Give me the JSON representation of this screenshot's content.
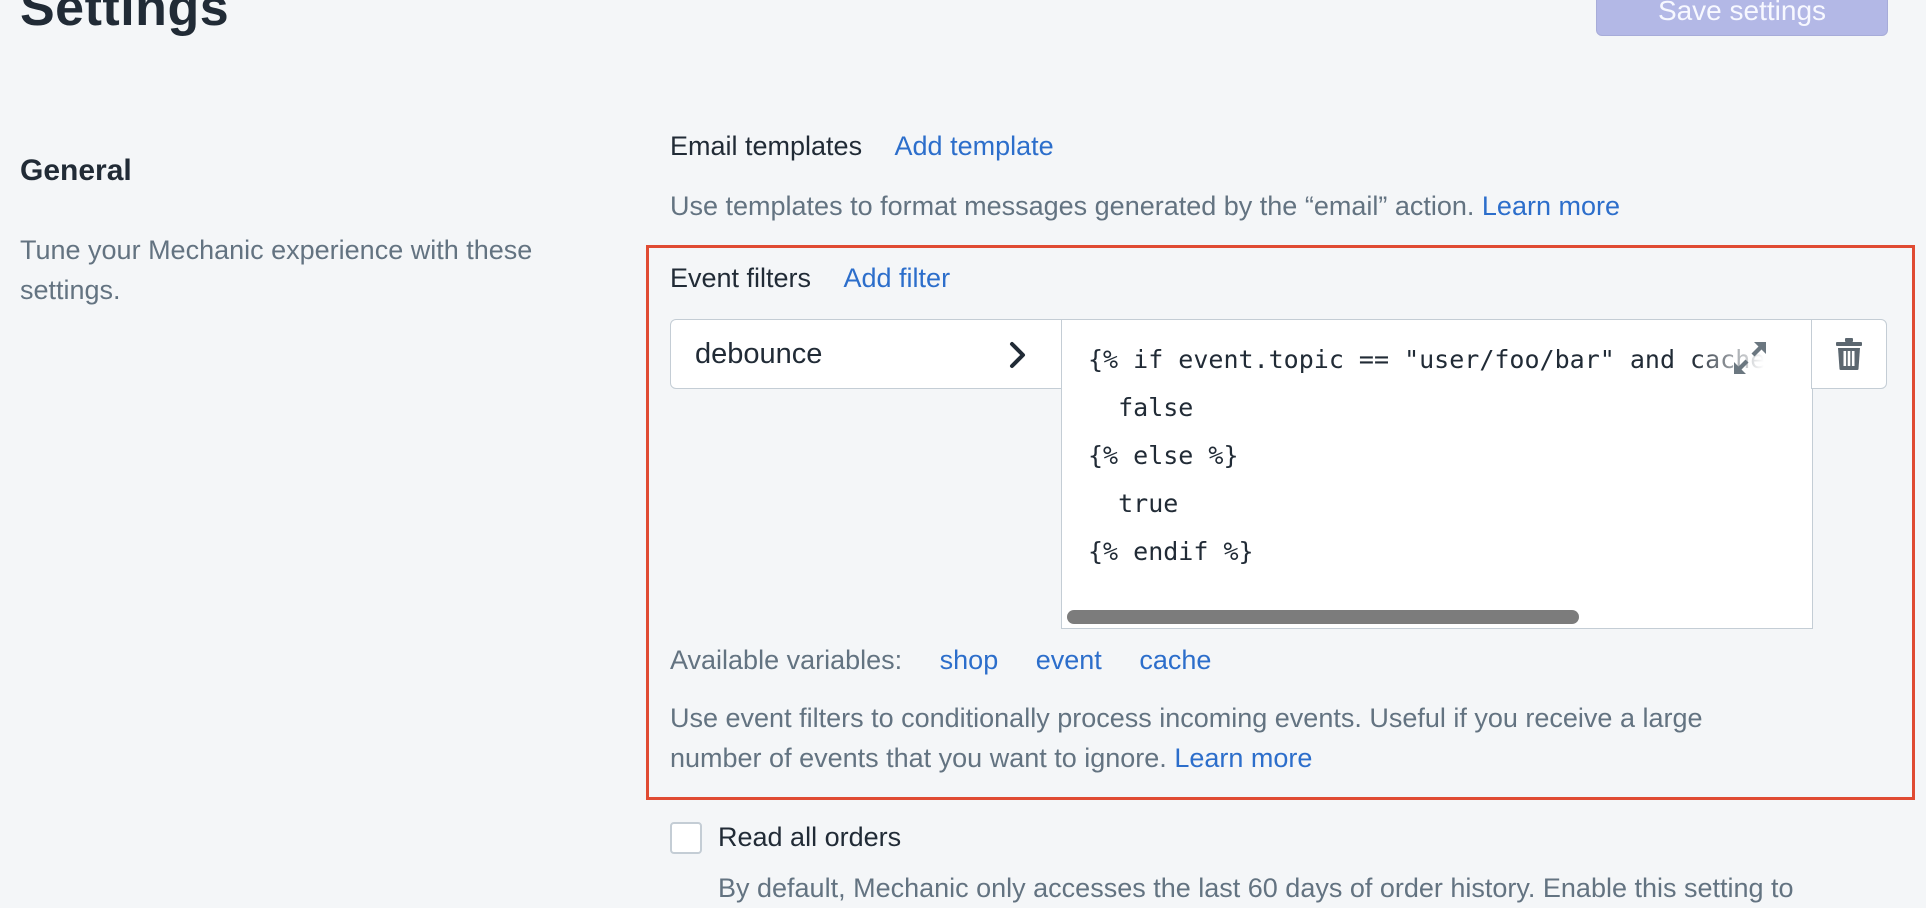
{
  "header": {
    "title": "Settings",
    "save_label": "Save settings"
  },
  "general": {
    "title": "General",
    "description": "Tune your Mechanic experience with these settings."
  },
  "email_templates": {
    "label": "Email templates",
    "add_link": "Add template",
    "help": "Use templates to format messages generated by the “email” action.",
    "learn_more": "Learn more"
  },
  "event_filters": {
    "label": "Event filters",
    "add_link": "Add filter",
    "filter": {
      "name": "debounce",
      "code_lines": [
        "{% if event.topic == \"user/foo/bar\" and cache",
        "  false",
        "{% else %}",
        "  true",
        "{% endif %}"
      ]
    },
    "variables_label": "Available variables:",
    "variables": [
      "shop",
      "event",
      "cache"
    ],
    "help_line1": "Use event filters to conditionally process incoming events. Useful if you receive a large",
    "help_line2": "number of events that you want to ignore.",
    "learn_more": "Learn more"
  },
  "read_all_orders": {
    "label": "Read all orders",
    "checked": false,
    "help_partial": "By default, Mechanic only accesses the last 60 days of order history. Enable this setting to"
  },
  "colors": {
    "link": "#2c6ecb",
    "highlight": "#e04b33",
    "save_disabled": "#b3b8e6"
  },
  "icons": [
    "chevron-right-icon",
    "expand-icon",
    "trash-icon"
  ]
}
